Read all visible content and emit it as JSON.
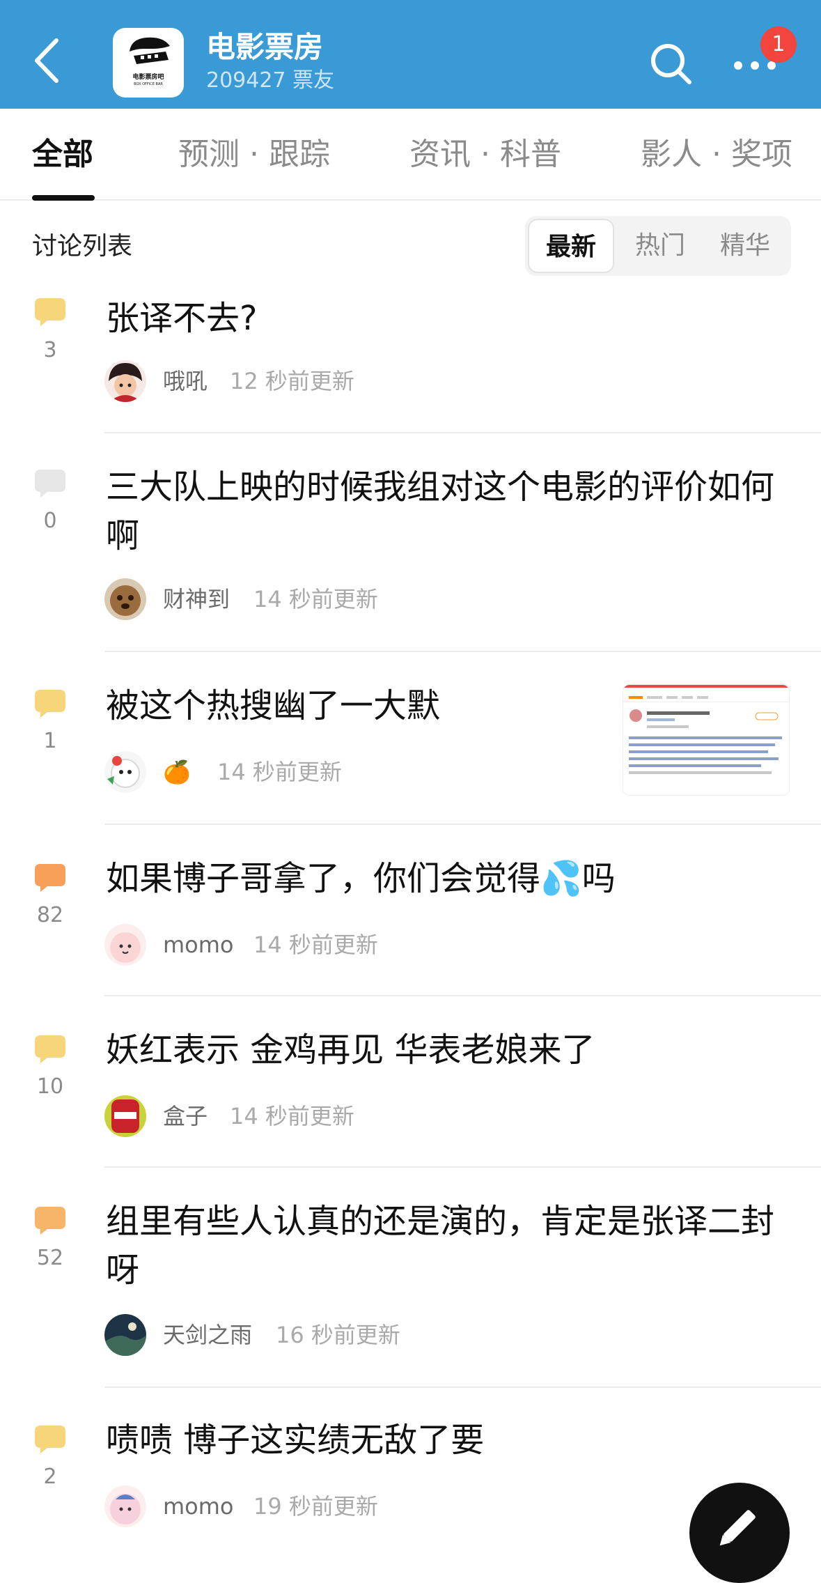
{
  "header": {
    "title": "电影票房",
    "members": "209427 票友",
    "logo_text": "电影票房吧",
    "logo_sub": "BOX OFFICE BAR",
    "notification_count": "1",
    "accent_color": "#3a9ad6"
  },
  "tabs": [
    {
      "label": "全部",
      "active": true
    },
    {
      "label": "预测 · 跟踪",
      "active": false
    },
    {
      "label": "资讯 · 科普",
      "active": false
    },
    {
      "label": "影人 · 奖项",
      "active": false
    }
  ],
  "list": {
    "section_label": "讨论列表",
    "sort_options": [
      {
        "label": "最新",
        "active": true
      },
      {
        "label": "热门",
        "active": false
      },
      {
        "label": "精华",
        "active": false
      }
    ]
  },
  "threads": [
    {
      "title": "张译不去?",
      "replies": "3",
      "author": "哦吼",
      "time": "12 秒前更新",
      "icon_color": "#f7d57b",
      "avatar": "red-hair-character"
    },
    {
      "title": "三大队上映的时候我组对这个电影的评价如何啊",
      "replies": "0",
      "author": "财神到",
      "time": "14 秒前更新",
      "icon_color": "#e6e6e6",
      "avatar": "puppy"
    },
    {
      "title": "被这个热搜幽了一大默",
      "replies": "1",
      "author": "🍊",
      "time": "14 秒前更新",
      "icon_color": "#f7d57b",
      "avatar": "cartoon-dog",
      "has_thumbnail": true
    },
    {
      "title": "如果博子哥拿了，你们会觉得💦吗",
      "replies": "82",
      "author": "momo",
      "time": "14 秒前更新",
      "icon_color": "#f7a05a",
      "avatar": "pink-blob"
    },
    {
      "title": "妖红表示 金鸡再见 华表老娘来了",
      "replies": "10",
      "author": "盒子",
      "time": "14 秒前更新",
      "icon_color": "#f7d57b",
      "avatar": "snack-can"
    },
    {
      "title": "组里有些人认真的还是演的，肯定是张译二封呀",
      "replies": "52",
      "author": "天剑之雨",
      "time": "16 秒前更新",
      "icon_color": "#f7b56a",
      "avatar": "landscape"
    },
    {
      "title": "啧啧 博子这实绩无敌了要",
      "replies": "2",
      "author": "momo",
      "time": "19 秒前更新",
      "icon_color": "#f7d57b",
      "avatar": "pink-blob-2"
    }
  ]
}
